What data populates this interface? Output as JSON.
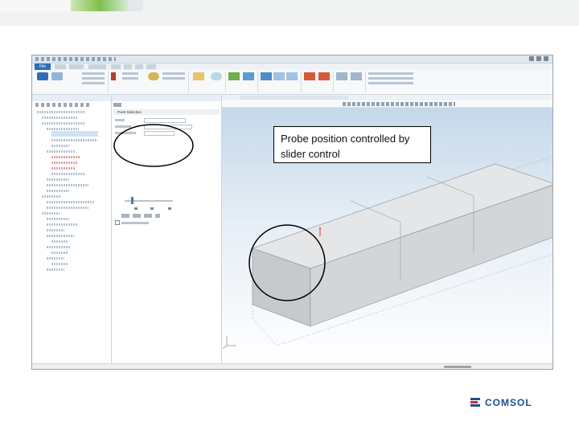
{
  "callout_text": "Probe position controlled by slider control",
  "brand": {
    "logo_text": "COMSOL",
    "colors": {
      "primary": "#1f4e8c",
      "accent": "#d8272d"
    }
  },
  "app": {
    "file_tab": "File"
  },
  "settings": {
    "section_title": "Point Selection"
  }
}
